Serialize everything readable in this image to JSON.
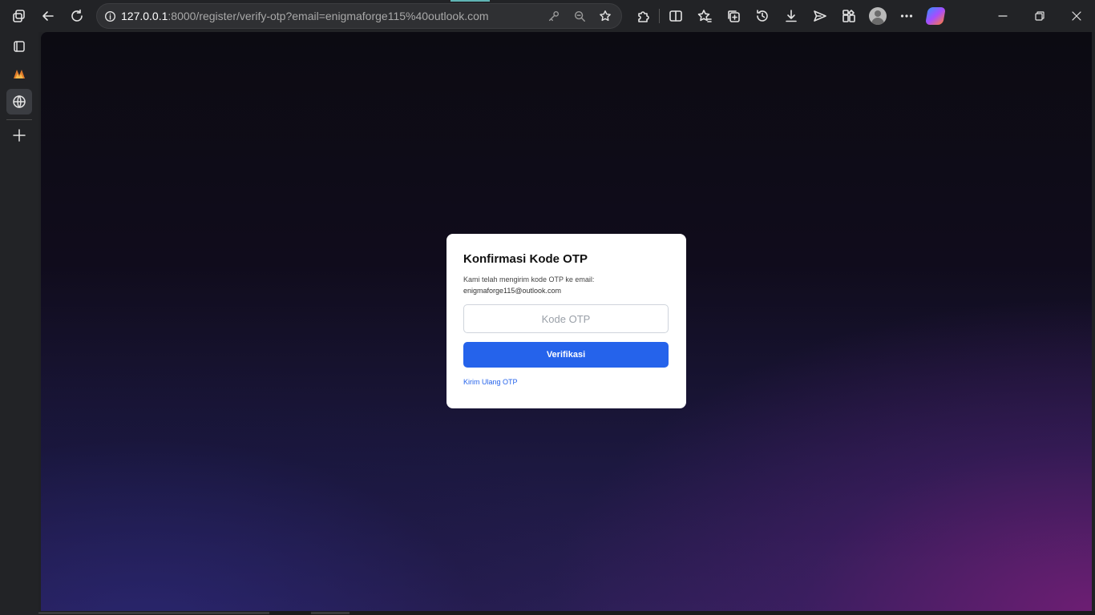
{
  "browser": {
    "url_host": "127.0.0.1",
    "url_path": ":8000/register/verify-otp?email=enigmaforge115%40outlook.com"
  },
  "page": {
    "title": "Konfirmasi Kode OTP",
    "description": "Kami telah mengirim kode OTP ke email:",
    "email": "enigmaforge115@outlook.com",
    "otp_input": {
      "placeholder": "Kode OTP",
      "value": ""
    },
    "verify_button": "Verifikasi",
    "resend_link": "Kirim Ulang OTP"
  },
  "colors": {
    "primary": "#2563eb",
    "card_bg": "#ffffff"
  },
  "icons": {
    "toolbar_left": [
      "workspaces-icon",
      "back-icon",
      "refresh-icon"
    ],
    "address_bar": [
      "site-info-icon",
      "key-icon",
      "zoom-icon",
      "favorite-star-icon"
    ],
    "toolbar_right": [
      "extensions-icon",
      "split-screen-icon",
      "favorites-icon",
      "collections-icon",
      "history-icon",
      "downloads-icon",
      "share-icon",
      "browser-essentials-icon",
      "profile-avatar-icon",
      "more-icon",
      "copilot-icon"
    ],
    "window": [
      "minimize-icon",
      "restore-icon",
      "close-icon"
    ],
    "sidebar": [
      "tab-actions-icon",
      "app-logo-icon",
      "globe-tab-icon",
      "new-tab-plus-icon"
    ]
  }
}
